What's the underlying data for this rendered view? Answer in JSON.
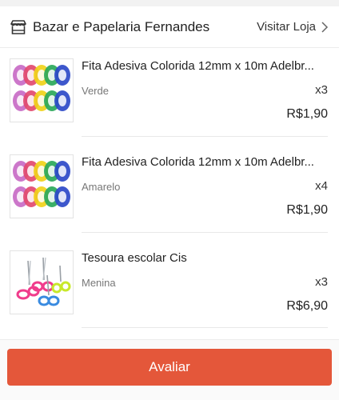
{
  "shop": {
    "name": "Bazar e Papelaria Fernandes",
    "visit_label": "Visitar Loja",
    "icon": "store-icon"
  },
  "items": [
    {
      "title": "Fita Adesiva Colorida 12mm x 10m Adelbr...",
      "variant": "Verde",
      "quantity": "x3",
      "price": "R$1,90",
      "image": "colored-tape-rolls"
    },
    {
      "title": "Fita Adesiva Colorida 12mm x 10m Adelbr...",
      "variant": "Amarelo",
      "quantity": "x4",
      "price": "R$1,90",
      "image": "colored-tape-rolls"
    },
    {
      "title": "Tesoura escolar Cis",
      "variant": "Menina",
      "quantity": "x3",
      "price": "R$6,90",
      "image": "school-scissors"
    }
  ],
  "footer": {
    "rate_label": "Avaliar"
  },
  "colors": {
    "accent": "#e4573a",
    "tape": [
      "#c86bc6",
      "#e24a6f",
      "#f0d21a",
      "#2aa85a",
      "#2c49c8"
    ],
    "scissors": [
      "#f03c8c",
      "#3a8be0",
      "#c8e82a"
    ]
  }
}
